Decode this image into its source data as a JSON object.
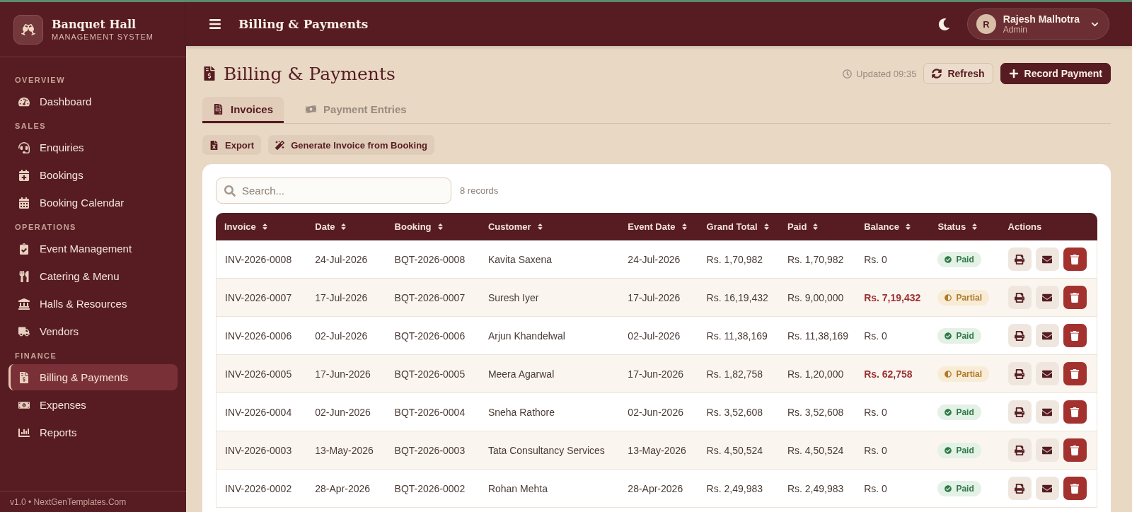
{
  "brand": {
    "title": "Banquet Hall",
    "subtitle": "MANAGEMENT SYSTEM"
  },
  "sidebar": {
    "sections": [
      {
        "heading": "OVERVIEW",
        "items": [
          {
            "label": "Dashboard",
            "selected": false
          }
        ]
      },
      {
        "heading": "SALES",
        "items": [
          {
            "label": "Enquiries",
            "selected": false
          },
          {
            "label": "Bookings",
            "selected": false
          },
          {
            "label": "Booking Calendar",
            "selected": false
          }
        ]
      },
      {
        "heading": "OPERATIONS",
        "items": [
          {
            "label": "Event Management",
            "selected": false
          },
          {
            "label": "Catering & Menu",
            "selected": false
          },
          {
            "label": "Halls & Resources",
            "selected": false
          },
          {
            "label": "Vendors",
            "selected": false
          }
        ]
      },
      {
        "heading": "FINANCE",
        "items": [
          {
            "label": "Billing & Payments",
            "selected": true
          },
          {
            "label": "Expenses",
            "selected": false
          },
          {
            "label": "Reports",
            "selected": false
          }
        ]
      }
    ],
    "footer": "v1.0 • NextGenTemplates.Com"
  },
  "header": {
    "title": "Billing & Payments",
    "user": {
      "initial": "R",
      "name": "Rajesh Malhotra",
      "role": "Admin"
    }
  },
  "page": {
    "title": "Billing & Payments",
    "updated": "Updated 09:35",
    "refresh": "Refresh",
    "primary": "Record Payment"
  },
  "tabs": [
    {
      "label": "Invoices",
      "selected": true
    },
    {
      "label": "Payment Entries",
      "selected": false
    }
  ],
  "actions": [
    "Export",
    "Generate Invoice from Booking"
  ],
  "search": {
    "placeholder": "Search..."
  },
  "record_count": "8 records",
  "table": {
    "columns": [
      {
        "label": "Invoice",
        "sortable": true
      },
      {
        "label": "Date",
        "sortable": true
      },
      {
        "label": "Booking",
        "sortable": true
      },
      {
        "label": "Customer",
        "sortable": true
      },
      {
        "label": "Event Date",
        "sortable": true
      },
      {
        "label": "Grand Total",
        "sortable": true
      },
      {
        "label": "Paid",
        "sortable": true
      },
      {
        "label": "Balance",
        "sortable": true
      },
      {
        "label": "Status",
        "sortable": true
      },
      {
        "label": "Actions",
        "sortable": false
      }
    ],
    "rows": [
      {
        "invoice": "INV-2026-0008",
        "date": "24-Jul-2026",
        "booking": "BQT-2026-0008",
        "customer": "Kavita Saxena",
        "event_date": "24-Jul-2026",
        "grand_total": "Rs. 1,70,982",
        "paid": "Rs. 1,70,982",
        "balance": "Rs. 0",
        "balance_due": false,
        "status": {
          "label": "Paid",
          "kind": "paid"
        }
      },
      {
        "invoice": "INV-2026-0007",
        "date": "17-Jul-2026",
        "booking": "BQT-2026-0007",
        "customer": "Suresh Iyer",
        "event_date": "17-Jul-2026",
        "grand_total": "Rs. 16,19,432",
        "paid": "Rs. 9,00,000",
        "balance": "Rs. 7,19,432",
        "balance_due": true,
        "status": {
          "label": "Partial",
          "kind": "partial"
        }
      },
      {
        "invoice": "INV-2026-0006",
        "date": "02-Jul-2026",
        "booking": "BQT-2026-0006",
        "customer": "Arjun Khandelwal",
        "event_date": "02-Jul-2026",
        "grand_total": "Rs. 11,38,169",
        "paid": "Rs. 11,38,169",
        "balance": "Rs. 0",
        "balance_due": false,
        "status": {
          "label": "Paid",
          "kind": "paid"
        }
      },
      {
        "invoice": "INV-2026-0005",
        "date": "17-Jun-2026",
        "booking": "BQT-2026-0005",
        "customer": "Meera Agarwal",
        "event_date": "17-Jun-2026",
        "grand_total": "Rs. 1,82,758",
        "paid": "Rs. 1,20,000",
        "balance": "Rs. 62,758",
        "balance_due": true,
        "status": {
          "label": "Partial",
          "kind": "partial"
        }
      },
      {
        "invoice": "INV-2026-0004",
        "date": "02-Jun-2026",
        "booking": "BQT-2026-0004",
        "customer": "Sneha Rathore",
        "event_date": "02-Jun-2026",
        "grand_total": "Rs. 3,52,608",
        "paid": "Rs. 3,52,608",
        "balance": "Rs. 0",
        "balance_due": false,
        "status": {
          "label": "Paid",
          "kind": "paid"
        }
      },
      {
        "invoice": "INV-2026-0003",
        "date": "13-May-2026",
        "booking": "BQT-2026-0003",
        "customer": "Tata Consultancy Services",
        "event_date": "13-May-2026",
        "grand_total": "Rs. 4,50,524",
        "paid": "Rs. 4,50,524",
        "balance": "Rs. 0",
        "balance_due": false,
        "status": {
          "label": "Paid",
          "kind": "paid"
        }
      },
      {
        "invoice": "INV-2026-0002",
        "date": "28-Apr-2026",
        "booking": "BQT-2026-0002",
        "customer": "Rohan Mehta",
        "event_date": "28-Apr-2026",
        "grand_total": "Rs. 2,49,983",
        "paid": "Rs. 2,49,983",
        "balance": "Rs. 0",
        "balance_due": false,
        "status": {
          "label": "Paid",
          "kind": "paid"
        }
      }
    ]
  }
}
